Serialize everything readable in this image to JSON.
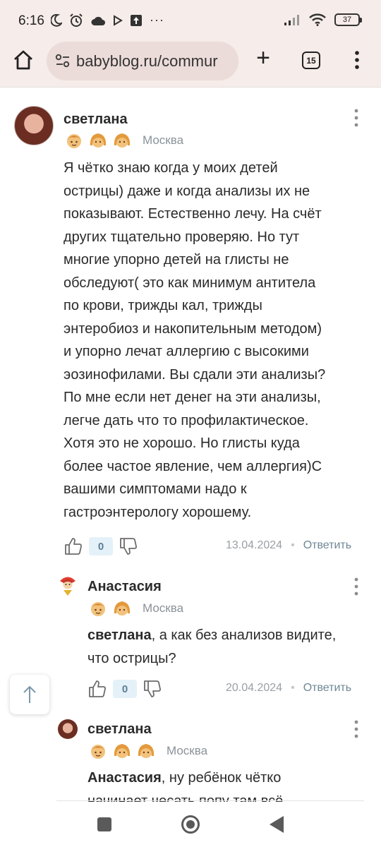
{
  "status_bar": {
    "time": "6:16",
    "battery": "37"
  },
  "browser": {
    "url": "babyblog.ru/commur",
    "tab_count": "15"
  },
  "comments": [
    {
      "author": "светлана",
      "city": "Москва",
      "kids": [
        "boy",
        "girl",
        "girl"
      ],
      "text_lines": [
        "Я чётко знаю когда у моих детей",
        "острицы) даже и когда анализы их не",
        "показывают. Естественно лечу. На счёт",
        "других тщательно проверяю. Но тут",
        "многие упорно детей на глисты не",
        "обследуют( это как минимум антитела",
        "по крови, трижды кал, трижды",
        "энтеробиоз и накопительным методом)",
        "и упорно лечат аллергию с высокими",
        "эозинофилами. Вы сдали эти анализы?",
        "По мне если нет денег на эти анализы,",
        "легче дать что то профилактическое.",
        "Хотя это не хорошо. Но глисты куда",
        "более частое явление, чем аллергия)С",
        "вашими симптомами надо к",
        "гастроэнтерологу хорошему."
      ],
      "likes": "0",
      "date": "13.04.2024",
      "reply_label": "Ответить"
    },
    {
      "author": "Анастасия",
      "city": "Москва",
      "kids": [
        "boy",
        "girl"
      ],
      "mention": "светлана",
      "text_line1_rest": ", а как без анализов видите,",
      "text_line2": "что острицы?",
      "likes": "0",
      "date": "20.04.2024",
      "reply_label": "Ответить"
    },
    {
      "author": "светлана",
      "city": "Москва",
      "kids": [
        "boy",
        "girl",
        "girl"
      ],
      "mention": "Анастасия",
      "text_line1_rest": ", ну ребёнок чётко",
      "text_line2": "начинает чесать попу там всё"
    }
  ],
  "colors": {
    "chrome_bg": "#f6ece9",
    "url_bg": "#ecdcd9",
    "like_count_bg": "#e5f1f8",
    "muted_text": "#9aa0a4"
  }
}
